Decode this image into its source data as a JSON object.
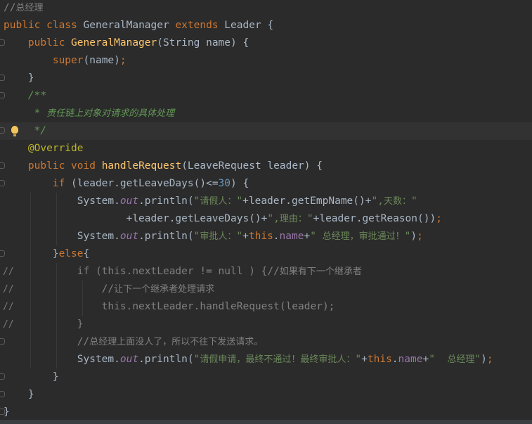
{
  "editor": {
    "lines": [
      [
        {
          "t": "//总经理",
          "c": "c"
        }
      ],
      [
        {
          "t": "public ",
          "c": "k"
        },
        {
          "t": "class ",
          "c": "k"
        },
        {
          "t": "GeneralManager ",
          "c": ""
        },
        {
          "t": "extends ",
          "c": "k"
        },
        {
          "t": "Leader {",
          "c": ""
        }
      ],
      [
        {
          "t": "    public ",
          "c": "k"
        },
        {
          "t": "GeneralManager",
          "c": "fn"
        },
        {
          "t": "(String name) {",
          "c": ""
        }
      ],
      [
        {
          "t": "        super",
          "c": "k"
        },
        {
          "t": "(name)",
          "c": ""
        },
        {
          "t": ";",
          "c": "k"
        }
      ],
      [
        {
          "t": "    }",
          "c": ""
        }
      ],
      [
        {
          "t": "    /**",
          "c": "dc"
        }
      ],
      [
        {
          "t": "     * 责任链上对象对请求的具体处理",
          "c": "dc"
        }
      ],
      [
        {
          "t": "     */",
          "c": "dc"
        }
      ],
      [
        {
          "t": "    @Override",
          "c": "an"
        }
      ],
      [
        {
          "t": "    public ",
          "c": "k"
        },
        {
          "t": "void ",
          "c": "k"
        },
        {
          "t": "handleRequest",
          "c": "fn"
        },
        {
          "t": "(LeaveRequest leader) {",
          "c": ""
        }
      ],
      [
        {
          "t": "        if ",
          "c": "k"
        },
        {
          "t": "(leader.getLeaveDays()<=",
          "c": ""
        },
        {
          "t": "30",
          "c": "n"
        },
        {
          "t": ") {",
          "c": ""
        }
      ],
      [
        {
          "t": "            System.",
          "c": ""
        },
        {
          "t": "out",
          "c": "fd"
        },
        {
          "t": ".println(",
          "c": ""
        },
        {
          "t": "\"请假人：\"",
          "c": "s"
        },
        {
          "t": "+leader.getEmpName()+",
          "c": ""
        },
        {
          "t": "\",天数：\"",
          "c": "s"
        }
      ],
      [
        {
          "t": "                    +leader.getLeaveDays()+",
          "c": ""
        },
        {
          "t": "\",理由：\"",
          "c": "s"
        },
        {
          "t": "+leader.getReason())",
          "c": ""
        },
        {
          "t": ";",
          "c": "k"
        }
      ],
      [
        {
          "t": "            System.",
          "c": ""
        },
        {
          "t": "out",
          "c": "fd"
        },
        {
          "t": ".println(",
          "c": ""
        },
        {
          "t": "\"审批人：\"",
          "c": "s"
        },
        {
          "t": "+",
          "c": ""
        },
        {
          "t": "this",
          "c": "k"
        },
        {
          "t": ".",
          "c": ""
        },
        {
          "t": "name",
          "c": "pf"
        },
        {
          "t": "+",
          "c": ""
        },
        {
          "t": "\" 总经理，审批通过！\"",
          "c": "s"
        },
        {
          "t": ")",
          "c": ""
        },
        {
          "t": ";",
          "c": "k"
        }
      ],
      [
        {
          "t": "        }",
          "c": ""
        },
        {
          "t": "else",
          "c": "k"
        },
        {
          "t": "{",
          "c": ""
        }
      ],
      [
        {
          "t": "            if (this.nextLeader != null ) {//如果有下一个继承者",
          "c": "c"
        }
      ],
      [
        {
          "t": "                //让下一个继承者处理请求",
          "c": "c"
        }
      ],
      [
        {
          "t": "                this.nextLeader.handleRequest(leader);",
          "c": "c"
        }
      ],
      [
        {
          "t": "            }",
          "c": "c"
        }
      ],
      [
        {
          "t": "            //总经理上面没人了，所以不往下发送请求。",
          "c": "c"
        }
      ],
      [
        {
          "t": "            System.",
          "c": ""
        },
        {
          "t": "out",
          "c": "fd"
        },
        {
          "t": ".println(",
          "c": ""
        },
        {
          "t": "\"请假申请，最终不通过！最终审批人：\"",
          "c": "s"
        },
        {
          "t": "+",
          "c": ""
        },
        {
          "t": "this",
          "c": "k"
        },
        {
          "t": ".",
          "c": ""
        },
        {
          "t": "name",
          "c": "pf"
        },
        {
          "t": "+",
          "c": ""
        },
        {
          "t": "\"  总经理\"",
          "c": "s"
        },
        {
          "t": ")",
          "c": ""
        },
        {
          "t": ";",
          "c": "k"
        }
      ],
      [
        {
          "t": "        }",
          "c": ""
        }
      ],
      [
        {
          "t": "    }",
          "c": ""
        }
      ],
      [
        {
          "t": "}",
          "c": ""
        }
      ]
    ],
    "gutter_markers": {
      "2": "fold",
      "4": "fold",
      "5": "fold",
      "7": "fold",
      "9": "fold",
      "10": "fold",
      "14": "fold",
      "15": "comment",
      "16": "comment",
      "17": "comment",
      "18": "comment",
      "19": "fold",
      "21": "fold",
      "22": "fold",
      "23": "fold"
    },
    "gutter_comment_text": "//",
    "bulb_line": 7,
    "caret_line": 7
  },
  "colors": {
    "background": "#2b2b2b",
    "keyword": "#cc7832",
    "method": "#ffc66d",
    "string": "#6a8759",
    "comment": "#808080",
    "doc_comment": "#629755",
    "annotation": "#bbb529",
    "field": "#9876aa",
    "number": "#6897bb"
  }
}
